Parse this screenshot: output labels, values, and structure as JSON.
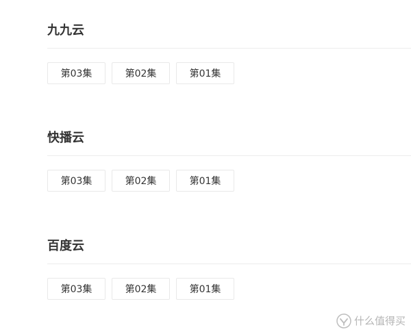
{
  "sections": [
    {
      "title": "九九云",
      "episodes": [
        "第03集",
        "第02集",
        "第01集"
      ]
    },
    {
      "title": "快播云",
      "episodes": [
        "第03集",
        "第02集",
        "第01集"
      ]
    },
    {
      "title": "百度云",
      "episodes": [
        "第03集",
        "第02集",
        "第01集"
      ]
    }
  ],
  "watermark": {
    "icon": "value-icon",
    "text": "什么值得买"
  }
}
